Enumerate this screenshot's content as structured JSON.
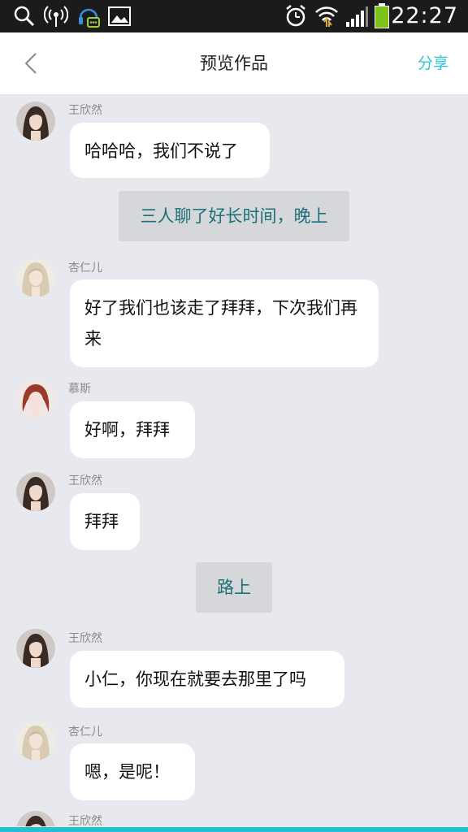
{
  "status_bar": {
    "time": "22:27",
    "icons": [
      "search-icon",
      "hotspot-icon",
      "headset-notification-icon",
      "image-icon",
      "alarm-icon",
      "wifi-icon",
      "signal-icon",
      "battery-icon"
    ],
    "battery_color": "#7cc21a"
  },
  "header": {
    "title": "预览作品",
    "share_label": "分享",
    "accent_color": "#2cc3d3"
  },
  "messages": [
    {
      "type": "chat",
      "name": "王欣然",
      "text": "哈哈哈，我们不说了",
      "avatar": "avatar-dark-hair"
    },
    {
      "type": "scene",
      "text": "三人聊了好长时间，晚上"
    },
    {
      "type": "chat",
      "name": "杏仁儿",
      "text": "好了我们也该走了拜拜，下次我们再来",
      "avatar": "avatar-blonde"
    },
    {
      "type": "chat",
      "name": "慕斯",
      "text": "好啊，拜拜",
      "avatar": "avatar-red-hair"
    },
    {
      "type": "chat",
      "name": "王欣然",
      "text": "拜拜",
      "avatar": "avatar-dark-hair"
    },
    {
      "type": "scene",
      "text": "路上"
    },
    {
      "type": "chat",
      "name": "王欣然",
      "text": "小仁，你现在就要去那里了吗",
      "avatar": "avatar-dark-hair"
    },
    {
      "type": "chat",
      "name": "杏仁儿",
      "text": "嗯，是呢！",
      "avatar": "avatar-blonde"
    },
    {
      "type": "chat",
      "name": "王欣然",
      "text": "",
      "avatar": "avatar-dark-hair"
    }
  ]
}
